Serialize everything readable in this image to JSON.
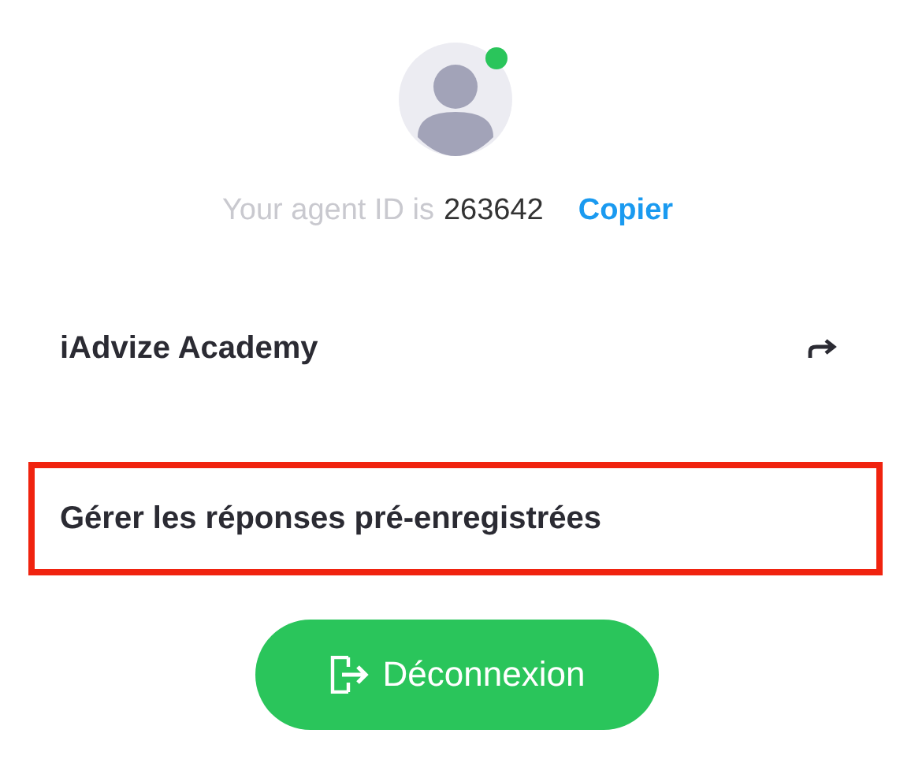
{
  "profile": {
    "online": true,
    "id_label": "Your agent ID is",
    "agent_id": "263642",
    "copy_link": "Copier"
  },
  "menu": [
    {
      "label": "iAdvize Academy",
      "kind": "external",
      "highlighted": false
    },
    {
      "label": "Gérer les réponses pré-enregistrées",
      "kind": "plain",
      "highlighted": true
    }
  ],
  "logout_button": "Déconnexion"
}
